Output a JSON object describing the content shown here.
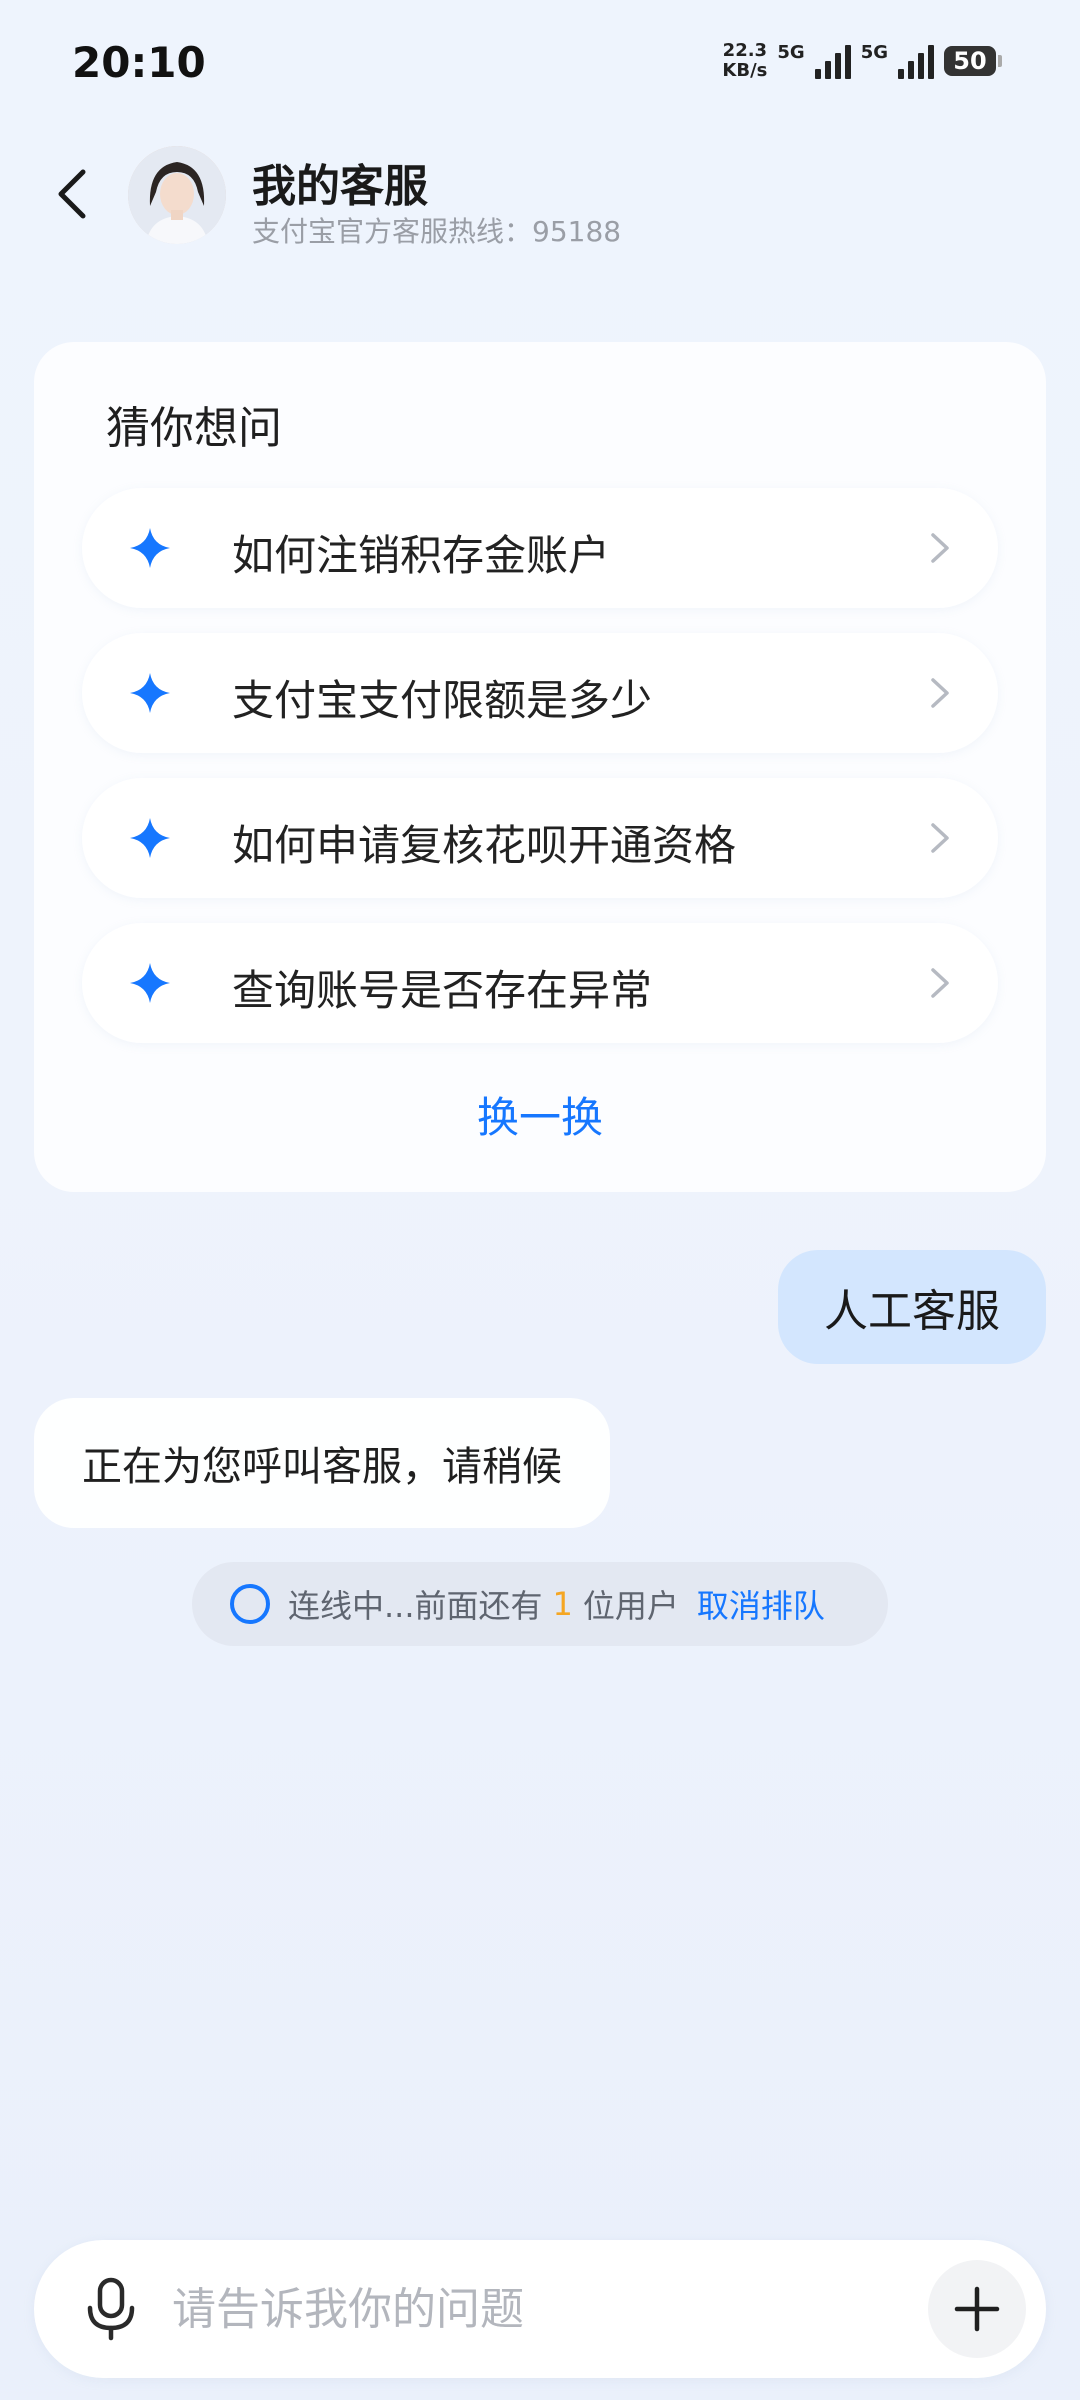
{
  "status_bar": {
    "time": "20:10",
    "net_speed_value": "22.3",
    "net_speed_unit": "KB/s",
    "net_type_1": "5G",
    "net_type_2": "5G",
    "battery": "50"
  },
  "header": {
    "title": "我的客服",
    "subtitle": "支付宝官方客服热线：95188"
  },
  "suggestions": {
    "title": "猜你想问",
    "items": [
      {
        "label": "如何注销积存金账户"
      },
      {
        "label": "支付宝支付限额是多少"
      },
      {
        "label": "如何申请复核花呗开通资格"
      },
      {
        "label": "查询账号是否存在异常"
      }
    ],
    "refresh_label": "换一换"
  },
  "chat": {
    "user_message": "人工客服",
    "bot_message": "正在为您呼叫客服，请稍候"
  },
  "queue": {
    "prefix": "连线中...前面还有",
    "count": "1",
    "suffix": "位用户",
    "cancel_label": "取消排队"
  },
  "input": {
    "placeholder": "请告诉我你的问题"
  },
  "colors": {
    "accent": "#1677ff",
    "user_bubble": "#d3e6fe",
    "queue_count": "#f5a623"
  },
  "icons": {
    "back": "chevron-left-icon",
    "suggestion": "sparkle-icon",
    "chevron": "chevron-right-icon",
    "mic": "microphone-icon",
    "plus": "plus-icon"
  }
}
